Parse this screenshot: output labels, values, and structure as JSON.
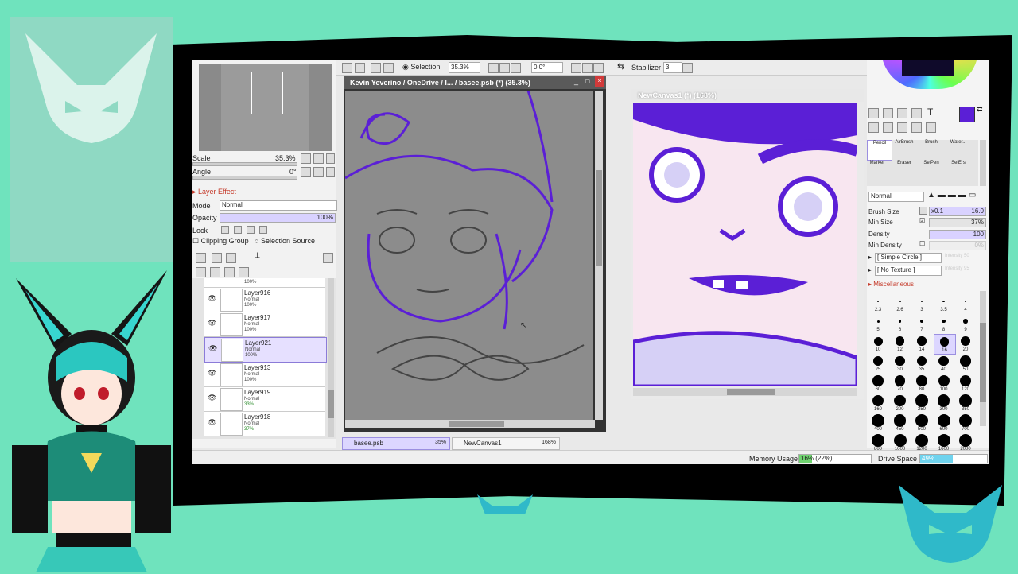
{
  "toolbar": {
    "selection_label": "Selection",
    "zoom_value": "35.3%",
    "rotation_value": "0.0°",
    "stabilizer_label": "Stabilizer",
    "stabilizer_value": "3"
  },
  "navigator": {
    "scale_label": "Scale",
    "scale_value": "35.3%",
    "angle_label": "Angle",
    "angle_value": "0°"
  },
  "layer_props": {
    "layer_effect_label": "Layer Effect",
    "mode_label": "Mode",
    "mode_value": "Normal",
    "opacity_label": "Opacity",
    "opacity_value": "100%",
    "lock_label": "Lock",
    "clipping_group_label": "Clipping Group",
    "selection_source_label": "Selection Source"
  },
  "layers": {
    "partial_top_opacity": "100%",
    "items": [
      {
        "name": "Layer916",
        "mode": "Normal",
        "opacity": "100%",
        "selected": false
      },
      {
        "name": "Layer917",
        "mode": "Normal",
        "opacity": "100%",
        "selected": false
      },
      {
        "name": "Layer921",
        "mode": "Normal",
        "opacity": "100%",
        "selected": true
      },
      {
        "name": "Layer913",
        "mode": "Normal",
        "opacity": "100%",
        "selected": false
      },
      {
        "name": "Layer919",
        "mode": "Normal",
        "opacity": "33%",
        "selected": false
      },
      {
        "name": "Layer918",
        "mode": "Normal",
        "opacity": "37%",
        "selected": false
      }
    ]
  },
  "canvas_main": {
    "title": "Kevin Yeverino / OneDrive / I...  / basee.psb (*) (35.3%)"
  },
  "canvas_second": {
    "title": "NewCanvas1 (*) (168%)"
  },
  "tabs": [
    {
      "label": "basee.psb",
      "zoom": "35%"
    },
    {
      "label": "NewCanvas1",
      "zoom": "168%"
    }
  ],
  "tools": {
    "row1": [
      "Pencil",
      "AirBrush",
      "Brush",
      "Water..."
    ],
    "row2": [
      "Marker",
      "Eraser",
      "SelPen",
      "SelErs"
    ],
    "blend_value": "Normal",
    "brush_size_label": "Brush Size",
    "brush_size_mult": "x0.1",
    "brush_size_value": "16.0",
    "min_size_label": "Min Size",
    "min_size_value": "37%",
    "density_label": "Density",
    "density_value": "100",
    "min_density_label": "Min Density",
    "min_density_value": "0%",
    "shape_value": "[ Simple Circle ]",
    "shape_intensity": "Intensity 50",
    "texture_value": "[ No Texture ]",
    "texture_intensity": "Intensity 95",
    "misc_label": "Miscellaneous",
    "accent_color": "#5b1fd6",
    "size_rows": [
      [
        "2.3",
        "2.6",
        "3",
        "3.5",
        "4"
      ],
      [
        "5",
        "6",
        "7",
        "8",
        "9"
      ],
      [
        "10",
        "12",
        "14",
        "16",
        "20"
      ],
      [
        "25",
        "30",
        "35",
        "40",
        "50"
      ],
      [
        "60",
        "70",
        "80",
        "100",
        "120"
      ],
      [
        "160",
        "200",
        "250",
        "300",
        "350"
      ],
      [
        "400",
        "450",
        "500",
        "600",
        "700"
      ],
      [
        "800",
        "1000",
        "1200",
        "1600",
        "2000"
      ]
    ],
    "selected_size": "16"
  },
  "status": {
    "memory_label": "Memory Usage",
    "memory_value": "16% (22%)",
    "drive_label": "Drive Space",
    "drive_value": "49%"
  },
  "colors": {
    "background": "#6fe3bd",
    "accent_purple": "#5b1fd6",
    "selection_highlight": "#e6e0ff"
  }
}
